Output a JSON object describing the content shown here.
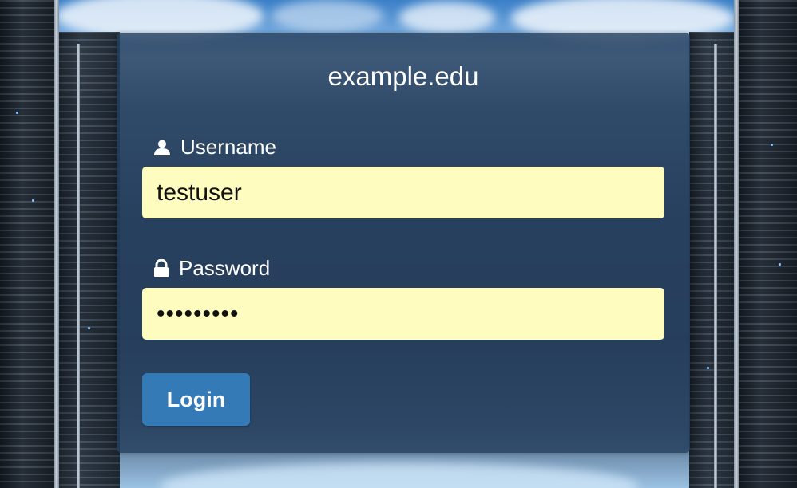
{
  "site": {
    "title": "example.edu"
  },
  "form": {
    "username_label": "Username",
    "username_value": "testuser",
    "password_label": "Password",
    "password_value": "testuser1",
    "login_label": "Login"
  },
  "icons": {
    "username": "user-icon",
    "password": "lock-icon"
  },
  "colors": {
    "card_background": "#26405e",
    "input_background": "#fefdbf",
    "button_background": "#337ab7",
    "text": "#ffffff"
  }
}
